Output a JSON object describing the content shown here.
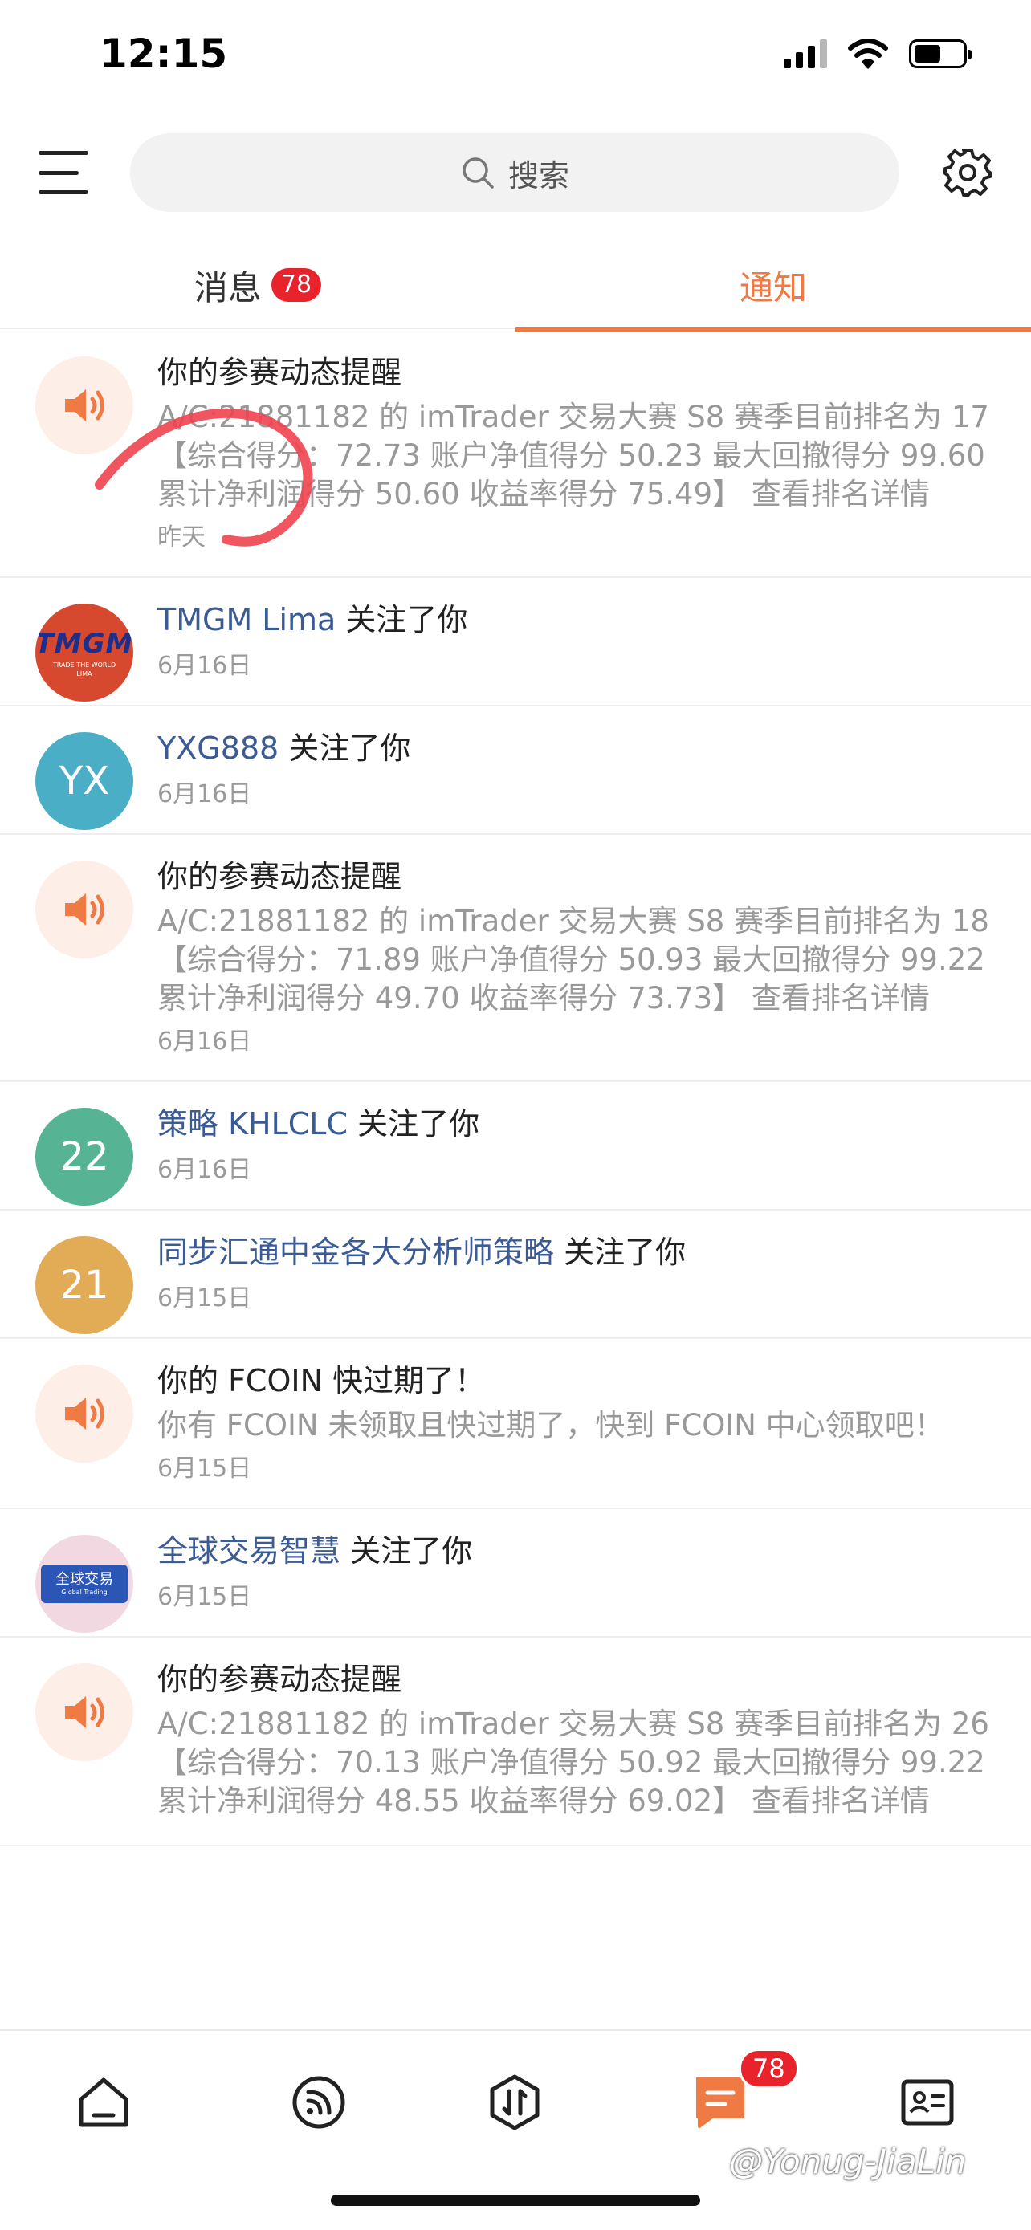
{
  "status_bar": {
    "time": "12:15"
  },
  "search": {
    "placeholder": "搜索"
  },
  "tabs": {
    "messages": {
      "label": "消息",
      "badge": "78"
    },
    "notifications": {
      "label": "通知"
    }
  },
  "notifications": [
    {
      "type": "system",
      "title": "你的参赛动态提醒",
      "body": "A/C:21881182 的 imTrader 交易大赛 S8 赛季目前排名为 17 【综合得分：72.73 账户净值得分 50.23 最大回撤得分 99.60 累计净利润得分 50.60 收益率得分 75.49】 查看排名详情",
      "date": "昨天"
    },
    {
      "type": "follow",
      "user": "TMGM Lima",
      "action": " 关注了你",
      "date": "6月16日",
      "avatar": {
        "kind": "logo",
        "brand": "TMGM",
        "tagline": "TRADE THE WORLD",
        "sub": "LIMA"
      }
    },
    {
      "type": "follow",
      "user": "YXG888",
      "action": " 关注了你",
      "date": "6月16日",
      "avatar": {
        "kind": "text",
        "text": "YX",
        "color": "#4aaec6"
      }
    },
    {
      "type": "system",
      "title": "你的参赛动态提醒",
      "body": "A/C:21881182 的 imTrader 交易大赛 S8 赛季目前排名为 18 【综合得分：71.89 账户净值得分 50.93 最大回撤得分 99.22 累计净利润得分 49.70 收益率得分 73.73】 查看排名详情",
      "date": "6月16日"
    },
    {
      "type": "follow",
      "user": "策略 KHLCLC",
      "action": " 关注了你",
      "date": "6月16日",
      "avatar": {
        "kind": "text",
        "text": "22",
        "color": "#56b394"
      }
    },
    {
      "type": "follow",
      "user": "同步汇通中金各大分析师策略",
      "action": " 关注了你",
      "date": "6月15日",
      "avatar": {
        "kind": "text",
        "text": "21",
        "color": "#e2ac57"
      }
    },
    {
      "type": "system",
      "title": "你的 FCOIN 快过期了！",
      "body": "你有 FCOIN 未领取且快过期了，快到 FCOIN 中心领取吧！",
      "date": "6月15日"
    },
    {
      "type": "follow",
      "user": "全球交易智慧",
      "action": " 关注了你",
      "date": "6月15日",
      "avatar": {
        "kind": "flag",
        "cn": "全球交易",
        "en": "Global Trading"
      }
    },
    {
      "type": "system",
      "title": "你的参赛动态提醒",
      "body": "A/C:21881182 的 imTrader 交易大赛 S8 赛季目前排名为 26 【综合得分：70.13 账户净值得分 50.92 最大回撤得分 99.22 累计净利润得分 48.55 收益率得分 69.02】 查看排名详情",
      "date": ""
    }
  ],
  "bottom_nav": {
    "badge": "78",
    "active": "messages"
  },
  "watermark": "@Yonug-JiaLin",
  "colors": {
    "accent": "#ef7a44",
    "badge": "#e8232b",
    "link": "#3b5b95"
  }
}
